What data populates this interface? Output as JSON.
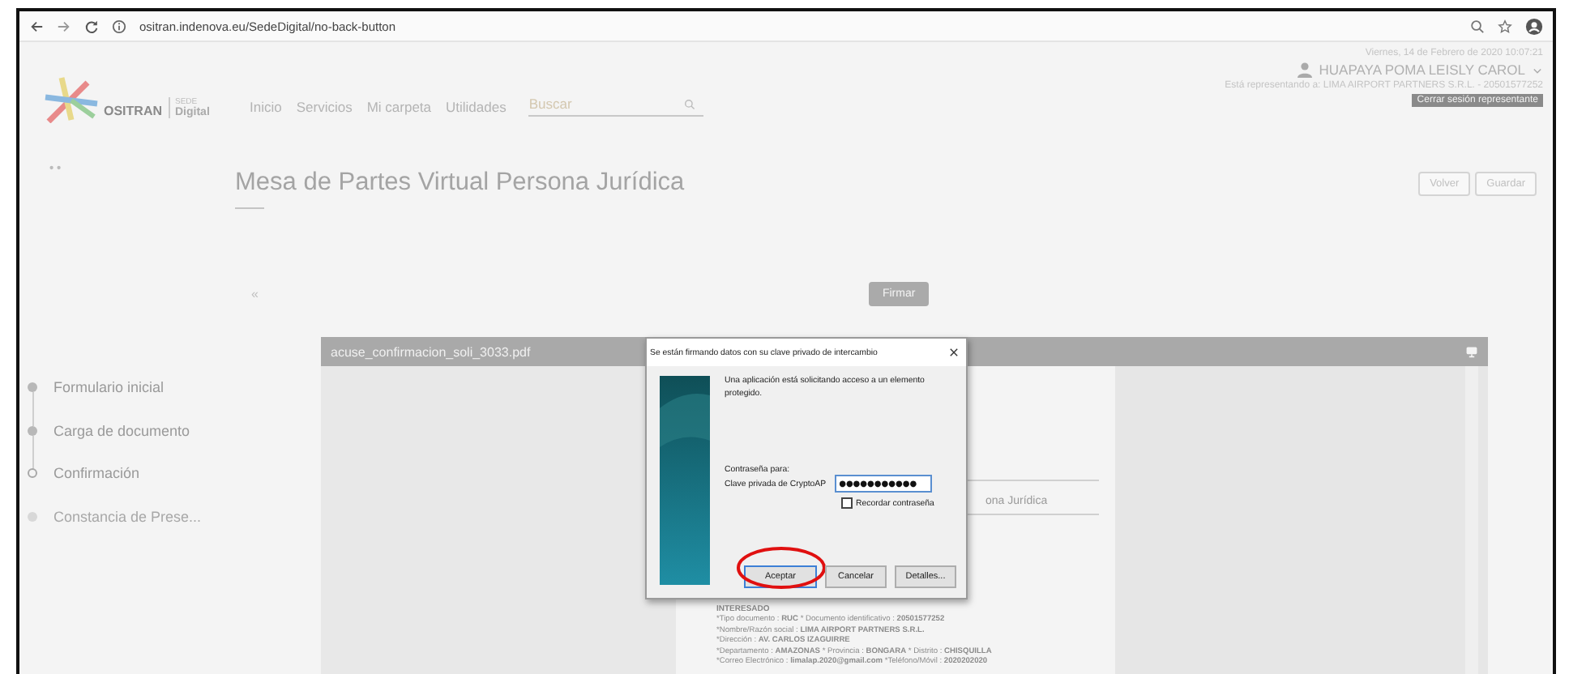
{
  "browser": {
    "url": "ositran.indenova.eu/SedeDigital/no-back-button"
  },
  "header": {
    "logo": {
      "name": "OSITRAN",
      "sede": "SEDE",
      "digital": "Digital"
    },
    "nav": [
      "Inicio",
      "Servicios",
      "Mi carpeta",
      "Utilidades"
    ],
    "search": {
      "placeholder": "Buscar"
    },
    "datetime": "Viernes, 14 de Febrero de 2020 10:07:21",
    "user": "HUAPAYA POMA LEISLY CAROL",
    "representing": "Está representando a: LIMA AIRPORT PARTNERS S.R.L. - 20501577252",
    "close_session": "Cerrar sesión representante"
  },
  "page": {
    "title": "Mesa de Partes Virtual Persona Jurídica",
    "buttons": [
      "Volver",
      "Guardar"
    ],
    "collapse": "«",
    "sign_button": "Firmar"
  },
  "steps": [
    {
      "label": "Formulario inicial",
      "completed": true,
      "selected": false
    },
    {
      "label": "Carga de documento",
      "completed": true,
      "selected": false
    },
    {
      "label": "Confirmación",
      "completed": false,
      "selected": true
    },
    {
      "label": "Constancia de Prese...",
      "completed": false,
      "selected": false
    }
  ],
  "viewer": {
    "filename": "acuse_confirmacion_soli_3033.pdf",
    "document": {
      "partial_heading": "ona Jurídica",
      "section": "INTERESADO",
      "lines": [
        "*Tipo documento : **RUC**   * Documento identificativo : **20501577252**",
        "*Nombre/Razón social : **LIMA AIRPORT PARTNERS S.R.L.**",
        "*Dirección : **AV. CARLOS IZAGUIRRE**",
        "*Departamento : **AMAZONAS**   * Provincia : **BONGARA**   * Distrito : **CHISQUILLA**",
        "*Correo Electrónico : **limalap.2020@gmail.com**   *Teléfono/Móvil : **2020202020**"
      ]
    }
  },
  "dialog": {
    "title": "Se están firmando datos con su clave privado de intercambio",
    "message": "Una aplicación está solicitando acceso a un elemento protegido.",
    "password_for": "Contraseña para:",
    "key_label": "Clave privada de CryptoAP",
    "password": "●●●●●●●●●●●",
    "remember": {
      "label": "Recordar contraseña",
      "checked": false
    },
    "buttons": [
      {
        "label": "Aceptar",
        "default": true,
        "circled": true
      },
      {
        "label": "Cancelar",
        "default": false,
        "circled": false
      },
      {
        "label": "Detalles...",
        "default": false,
        "circled": false
      }
    ]
  }
}
